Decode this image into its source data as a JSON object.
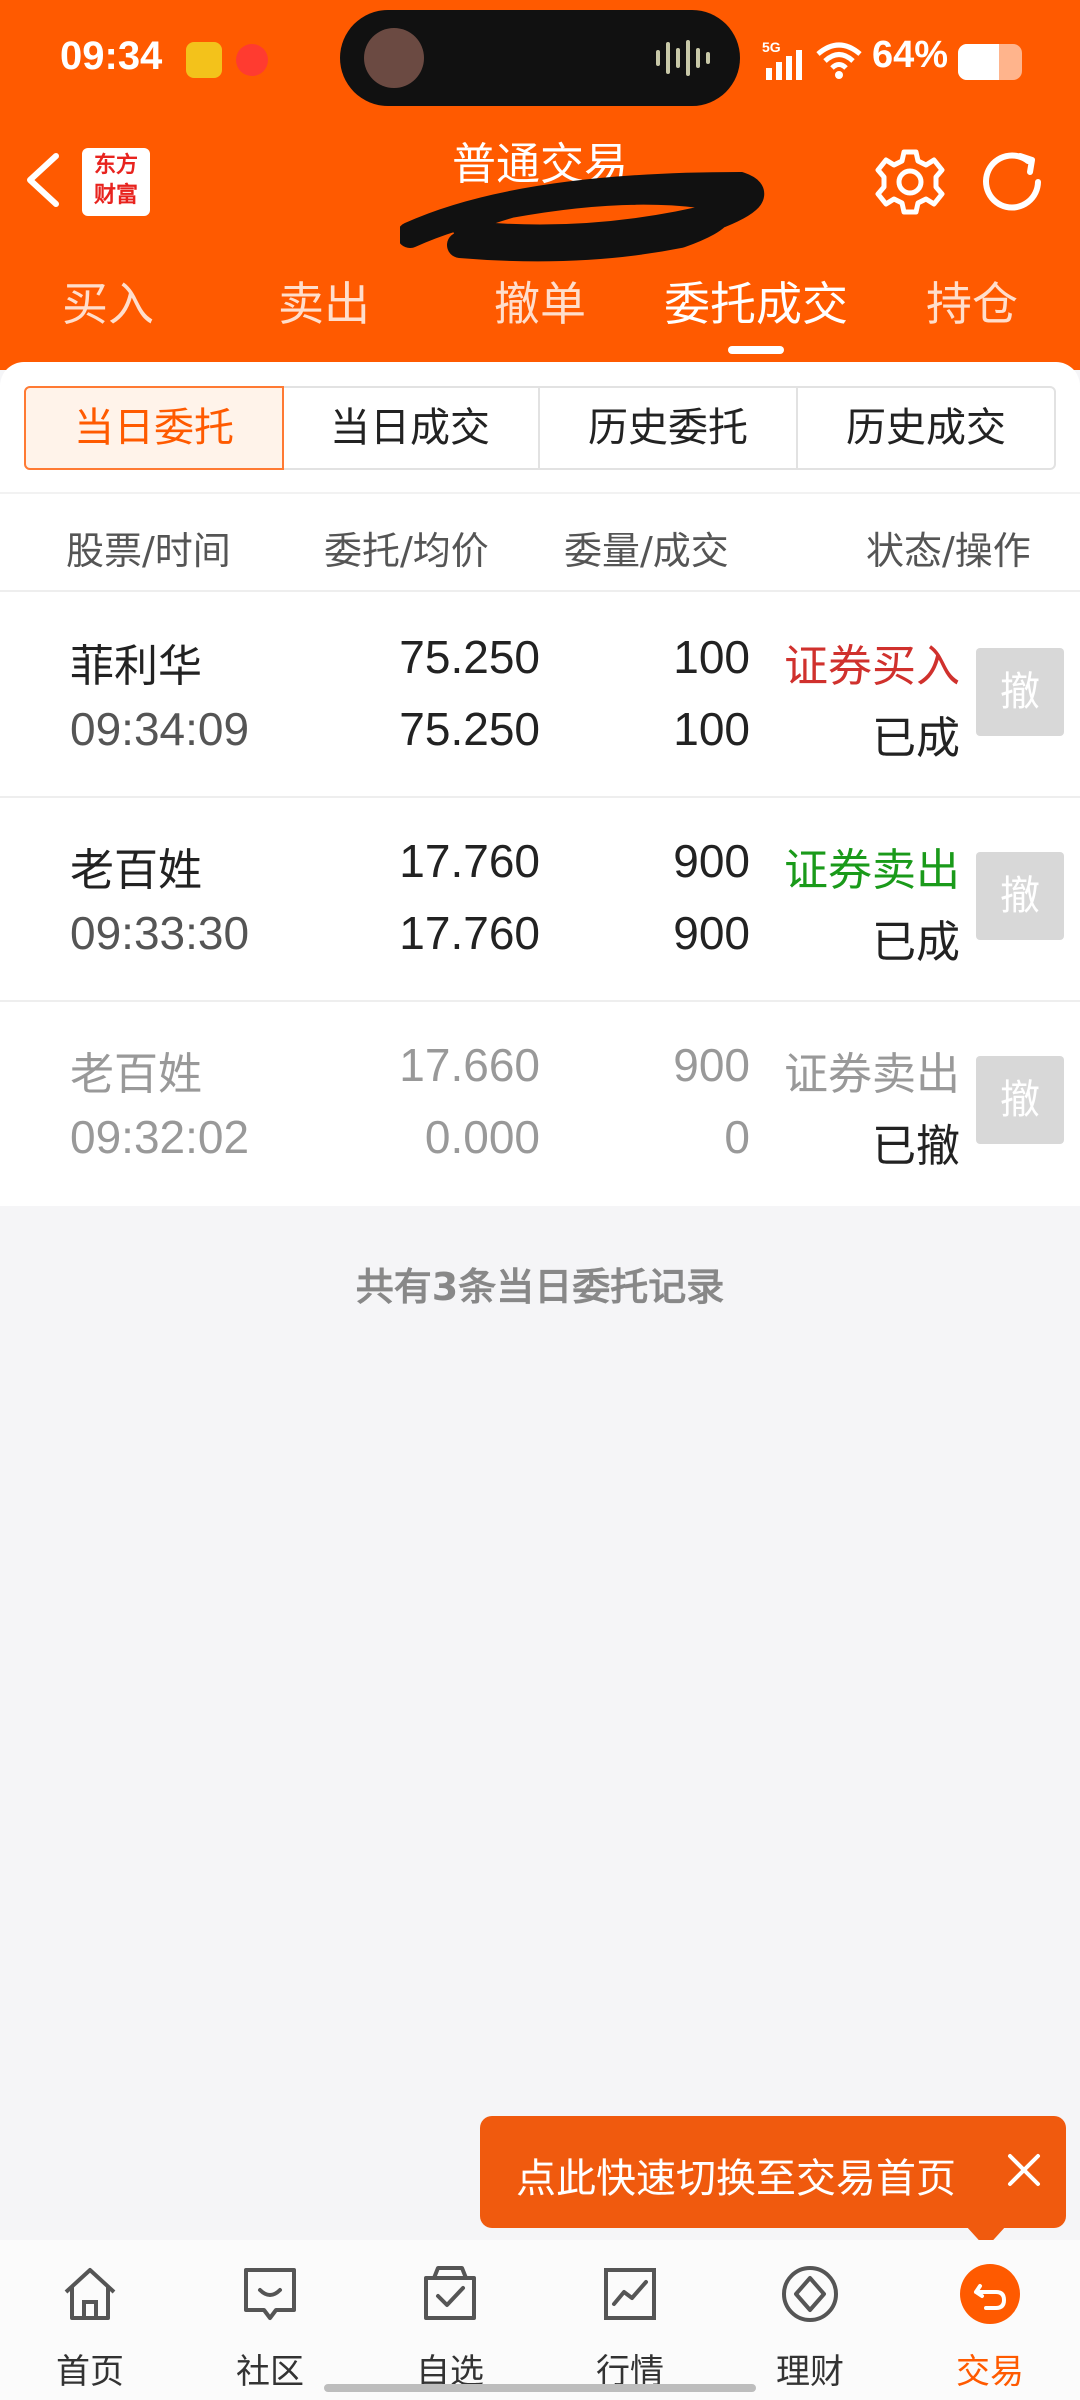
{
  "status_bar": {
    "time": "09:34",
    "network": "5G",
    "battery_percent": "64%",
    "battery_level": 0.64
  },
  "header": {
    "logo_line1": "东方",
    "logo_line2": "财富",
    "title": "普通交易"
  },
  "tabs": [
    {
      "label": "买入"
    },
    {
      "label": "卖出"
    },
    {
      "label": "撤单"
    },
    {
      "label": "委托成交",
      "active": true
    },
    {
      "label": "持仓"
    }
  ],
  "segments": [
    {
      "label": "当日委托",
      "active": true
    },
    {
      "label": "当日成交"
    },
    {
      "label": "历史委托"
    },
    {
      "label": "历史成交"
    }
  ],
  "table": {
    "headers": [
      "股票/时间",
      "委托/均价",
      "委量/成交",
      "状态/操作"
    ],
    "rows": [
      {
        "name": "菲利华",
        "time": "09:34:09",
        "order_price": "75.250",
        "avg_price": "75.250",
        "order_qty": "100",
        "filled_qty": "100",
        "direction": "证券买入",
        "status": "已成",
        "action": "撤"
      },
      {
        "name": "老百姓",
        "time": "09:33:30",
        "order_price": "17.760",
        "avg_price": "17.760",
        "order_qty": "900",
        "filled_qty": "900",
        "direction": "证券卖出",
        "status": "已成",
        "action": "撤"
      },
      {
        "name": "老百姓",
        "time": "09:32:02",
        "order_price": "17.660",
        "avg_price": "0.000",
        "order_qty": "900",
        "filled_qty": "0",
        "direction": "证券卖出",
        "status": "已撤",
        "action": "撤"
      }
    ]
  },
  "summary": "共有3条当日委托记录",
  "toast": {
    "text": "点此快速切换至交易首页"
  },
  "bottom_nav": [
    {
      "label": "首页",
      "icon": "home-icon"
    },
    {
      "label": "社区",
      "icon": "community-icon"
    },
    {
      "label": "自选",
      "icon": "watchlist-icon"
    },
    {
      "label": "行情",
      "icon": "market-icon"
    },
    {
      "label": "理财",
      "icon": "wealth-icon"
    },
    {
      "label": "交易",
      "icon": "trade-icon",
      "active": true
    }
  ],
  "colors": {
    "brand": "#ff5a00",
    "buy": "#d0312d",
    "sell": "#1a9a1a",
    "muted": "#999999"
  }
}
